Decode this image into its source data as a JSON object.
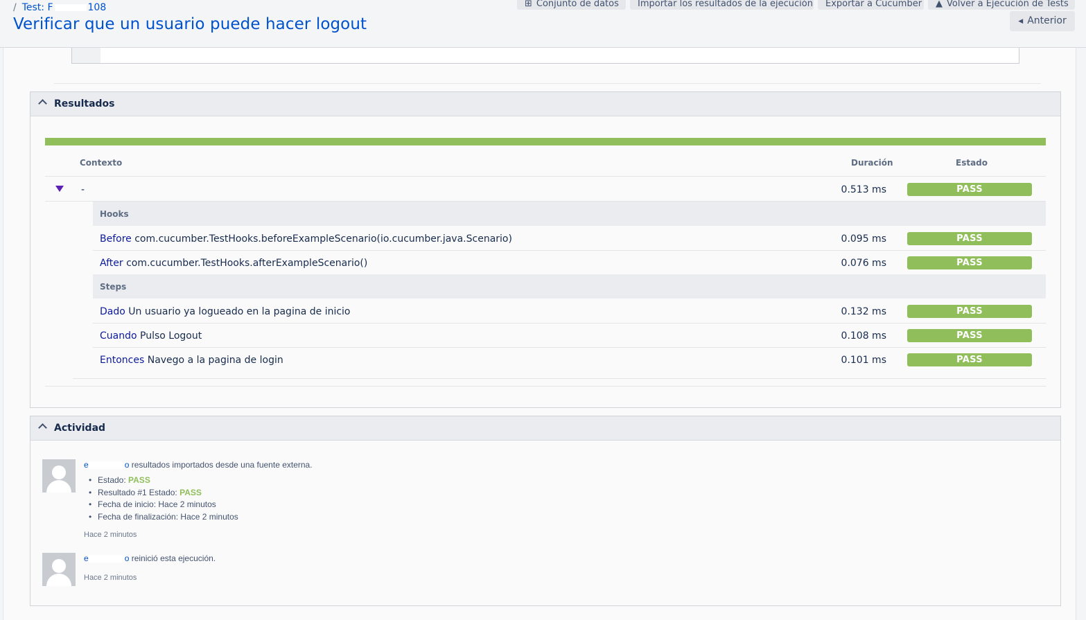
{
  "header": {
    "breadcrumb_sep": "/",
    "breadcrumb_label": "Test: F",
    "breadcrumb_suffix": "108",
    "title": "Verificar que un usuario puede hacer logout",
    "buttons": {
      "dataset": "Conjunto de datos",
      "import_results": "Importar los resultados de la ejecución",
      "export_cucumber": "Exportar a Cucumber",
      "back_to_exec": "Volver a Ejecución de Tests",
      "previous": "Anterior"
    }
  },
  "results": {
    "heading": "Resultados",
    "progress_pass_fraction": 1.0,
    "columns": {
      "context": "Contexto",
      "duration": "Duración",
      "status": "Estado"
    },
    "context_row": {
      "label": "-",
      "duration": "0.513 ms",
      "status": "PASS"
    },
    "hooks_label": "Hooks",
    "hooks": [
      {
        "keyword": "Before",
        "text": "com.cucumber.TestHooks.beforeExampleScenario(io.cucumber.java.Scenario)",
        "duration": "0.095 ms",
        "status": "PASS"
      },
      {
        "keyword": "After",
        "text": "com.cucumber.TestHooks.afterExampleScenario()",
        "duration": "0.076 ms",
        "status": "PASS"
      }
    ],
    "steps_label": "Steps",
    "steps": [
      {
        "keyword": "Dado",
        "text": "Un usuario ya logueado en la pagina de inicio",
        "duration": "0.132 ms",
        "status": "PASS"
      },
      {
        "keyword": "Cuando",
        "text": "Pulso Logout",
        "duration": "0.108 ms",
        "status": "PASS"
      },
      {
        "keyword": "Entonces",
        "text": "Navego a la pagina de login",
        "duration": "0.101 ms",
        "status": "PASS"
      }
    ],
    "colors": {
      "pass": "#8fbe5a"
    }
  },
  "activity": {
    "heading": "Actividad",
    "entries": [
      {
        "user_initial": "e",
        "user_end": "o",
        "message": "resultados importados desde una fuente externa.",
        "details": [
          {
            "label": "Estado: ",
            "value": "PASS"
          },
          {
            "label": "Resultado #1 Estado: ",
            "value": "PASS"
          },
          {
            "label": "Fecha de inicio: Hace 2 minutos",
            "value": ""
          },
          {
            "label": "Fecha de finalización: Hace 2 minutos",
            "value": ""
          }
        ],
        "time": "Hace 2 minutos"
      },
      {
        "user_initial": "e",
        "user_end": "o",
        "message": "reinició esta ejecución.",
        "time": "Hace 2 minutos"
      }
    ]
  }
}
